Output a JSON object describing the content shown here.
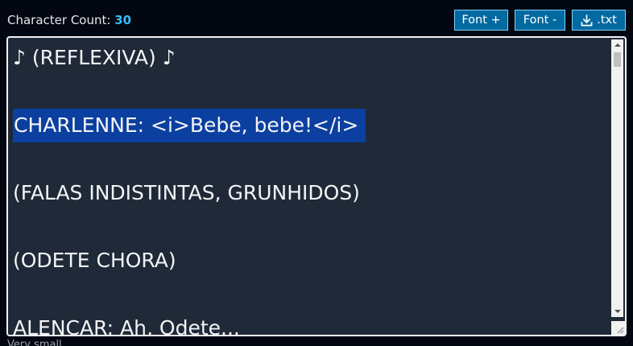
{
  "header": {
    "character_count_label": "Character Count:",
    "character_count_value": "30",
    "font_plus_label": "Font +",
    "font_minus_label": "Font -",
    "download_label": ".txt",
    "download_icon": "download-icon"
  },
  "editor": {
    "lines": [
      "♪ (REFLEXIVA) ♪",
      "",
      "CHARLENNE: <i>Bebe, bebe!</i>",
      "",
      "(FALAS INDISTINTAS, GRUNHIDOS)",
      "",
      "(ODETE CHORA)",
      "",
      "ALENCAR: Ah, Odete..."
    ],
    "selected_line_index": 2
  },
  "footer": {
    "partial_text": "Very small"
  },
  "colors": {
    "background": "#030712",
    "editor_background": "#1f2937",
    "accent": "#38bdf8",
    "button": "#0369a1",
    "selection": "#0b3fa0"
  }
}
